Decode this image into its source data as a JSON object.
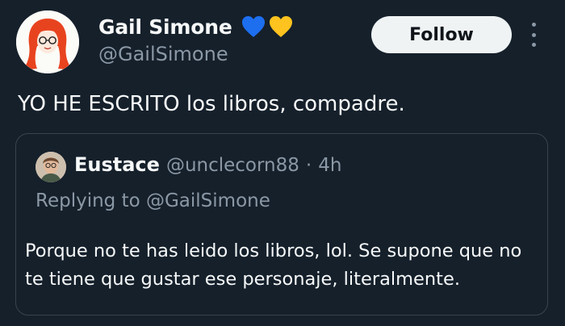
{
  "tweet": {
    "author": {
      "display_name": "Gail Simone",
      "handle": "@GailSimone",
      "avatar": "cartoon-redhead-avatar",
      "emoji": [
        "blue-heart-icon",
        "yellow-heart-icon"
      ]
    },
    "follow_label": "Follow",
    "more_icon": "more-vertical-icon",
    "text": "YO HE ESCRITO los libros, compadre."
  },
  "quoted": {
    "display_name": "Eustace",
    "handle": "@unclecorn88",
    "separator": "·",
    "time": "4h",
    "replying_to": "Replying to @GailSimone",
    "text": "Porque no te has leido los libros, lol. Se supone que no te tiene que gustar ese personaje, literalmente."
  },
  "colors": {
    "background": "#15202b",
    "primary_text": "#f7f9f9",
    "secondary_text": "#8b98a5",
    "border": "#38444d",
    "follow_bg": "#eff3f4",
    "blue_heart": "#1d6ff0",
    "yellow_heart": "#ffc31f",
    "hair": "#e8431f"
  }
}
